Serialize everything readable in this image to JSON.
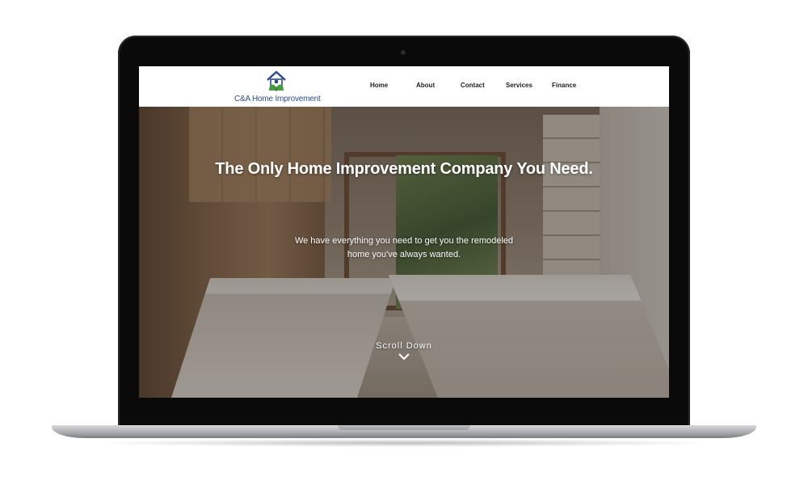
{
  "brand": {
    "name": "C&A Home Improvement",
    "logo_icon": "house-leaf-icon",
    "colors": {
      "text": "#2b4a8a",
      "leaf": "#4a9a3f",
      "roof": "#2b4a8a"
    }
  },
  "nav": {
    "items": [
      {
        "label": "Home"
      },
      {
        "label": "About"
      },
      {
        "label": "Contact"
      },
      {
        "label": "Services"
      },
      {
        "label": "Finance"
      }
    ]
  },
  "hero": {
    "headline": "The Only Home Improvement Company You Need.",
    "subtext_line1": "We have everything you need to get you the remodeled",
    "subtext_line2": "home you've always wanted.",
    "scroll_label": "Scroll Down",
    "scroll_icon": "chevron-down-icon",
    "background": "kitchen-photo"
  }
}
